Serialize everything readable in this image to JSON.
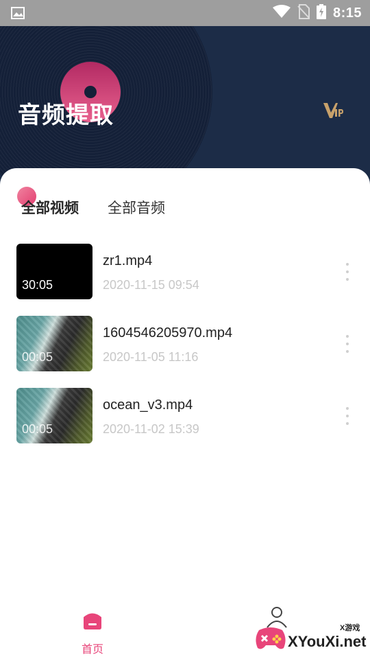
{
  "status_bar": {
    "time": "8:15",
    "icons": [
      "image-icon",
      "wifi-icon",
      "no-sim-icon",
      "battery-charging-icon"
    ]
  },
  "header": {
    "title": "音频提取",
    "vip_label": "VIP",
    "colors": {
      "background": "#1c2c47",
      "accent": "#e33f71",
      "vip_gold": "#c7a16b"
    }
  },
  "tabs": [
    {
      "label": "全部视频",
      "active": true
    },
    {
      "label": "全部音频",
      "active": false
    }
  ],
  "videos": [
    {
      "name": "zr1.mp4",
      "date": "2020-11-15 09:54",
      "duration": "30:05",
      "thumb": "black"
    },
    {
      "name": "1604546205970.mp4",
      "date": "2020-11-05 11:16",
      "duration": "00:05",
      "thumb": "aerial-coast"
    },
    {
      "name": "ocean_v3.mp4",
      "date": "2020-11-02 15:39",
      "duration": "00:05",
      "thumb": "aerial-coast"
    }
  ],
  "bottom_nav": {
    "home_label": "首页",
    "home_icon": "home-icon",
    "profile_icon": "profile-icon",
    "active_color": "#e8457a"
  },
  "watermark": {
    "text": "XYouXi.net",
    "small": "X游戏"
  }
}
